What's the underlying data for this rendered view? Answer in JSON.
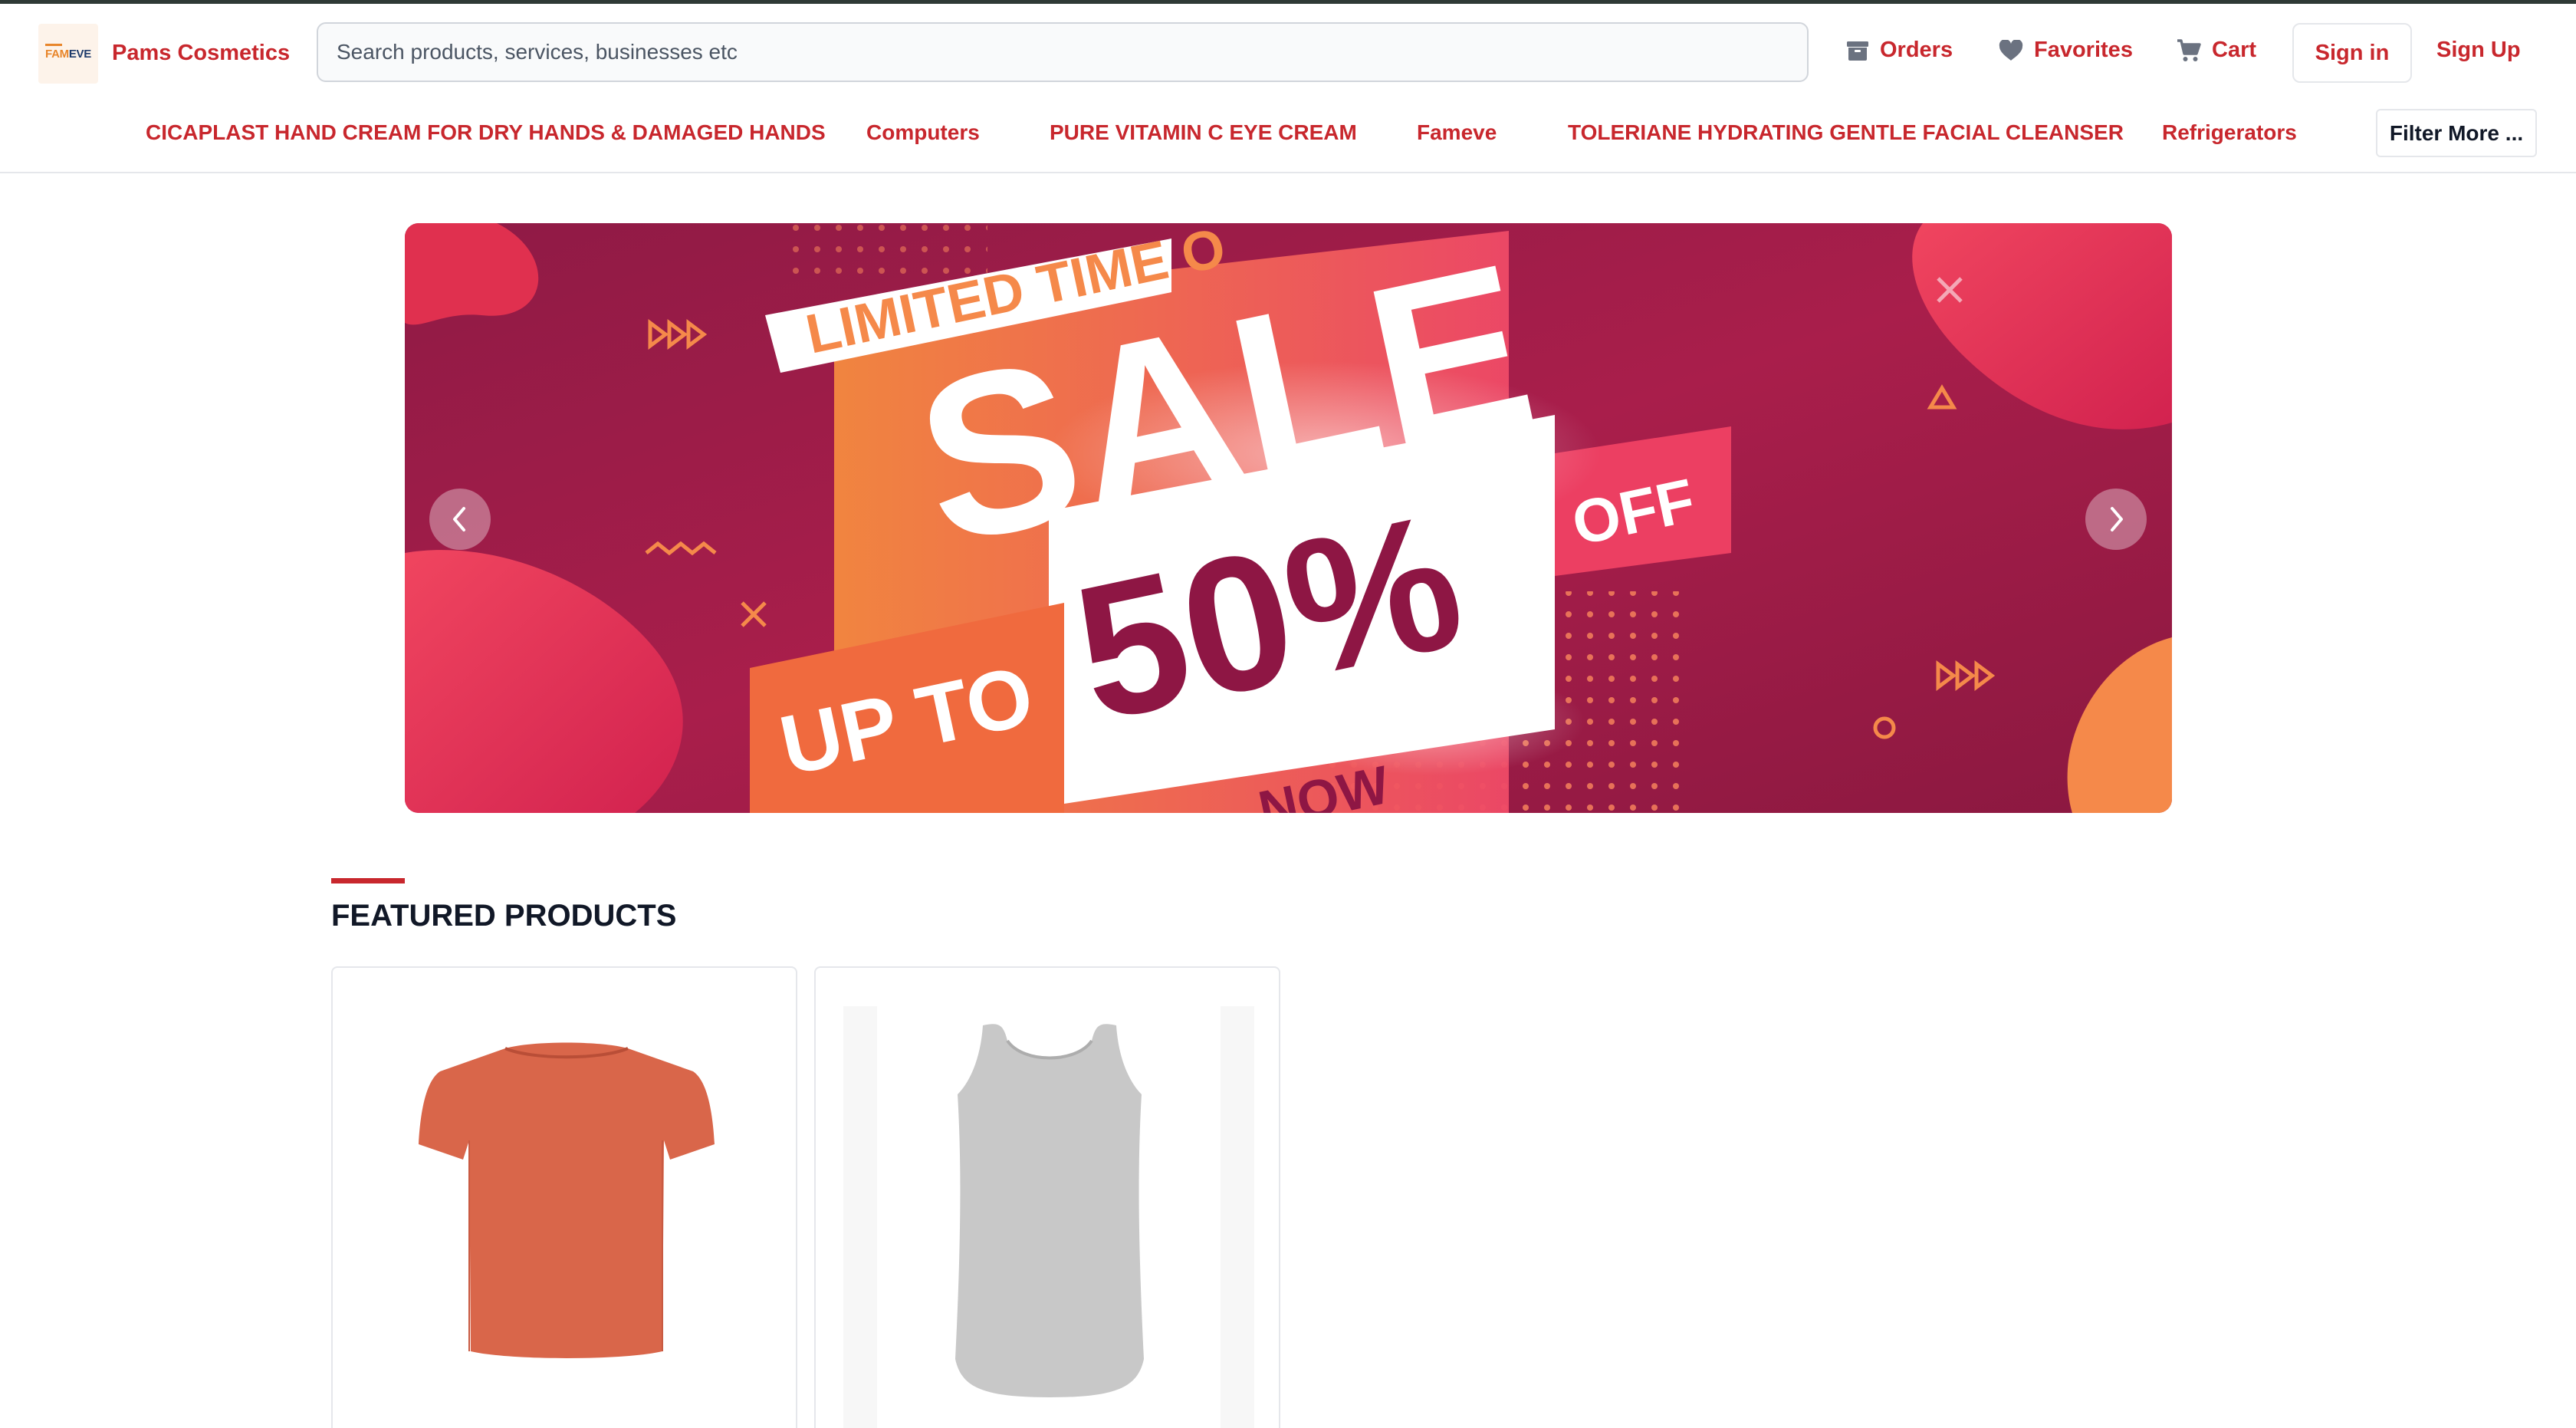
{
  "brand": {
    "logo_text_a": "FAM",
    "logo_text_b": "EVE",
    "name": "Pams Cosmetics"
  },
  "search": {
    "placeholder": "Search products, services, businesses etc"
  },
  "header_links": {
    "orders": "Orders",
    "favorites": "Favorites",
    "cart": "Cart",
    "sign_in": "Sign in",
    "sign_up": "Sign Up"
  },
  "categories": [
    "CICAPLAST HAND CREAM FOR DRY HANDS & DAMAGED HANDS",
    "Computers",
    "PURE VITAMIN C EYE CREAM",
    "Fameve",
    "TOLERIANE HYDRATING GENTLE FACIAL CLEANSER",
    "Refrigerators"
  ],
  "filter_more": "Filter More ...",
  "banner": {
    "ribbon": "LIMITED TIME O",
    "headline": "SALE",
    "up_to": "UP TO",
    "percent": "50%",
    "off": "OFF",
    "bottom": "NOW"
  },
  "featured": {
    "title": "FEATURED PRODUCTS"
  },
  "icons": {
    "orders": "archive-box-icon",
    "favorites": "heart-icon",
    "cart": "shopping-cart-icon",
    "prev": "chevron-left-icon",
    "next": "chevron-right-icon"
  },
  "colors": {
    "accent": "#c8272d",
    "banner_bg": "#a91e4b",
    "banner_orange": "#f5894a",
    "shirt_orange": "#d9664a",
    "tank_gray": "#c8c8c8"
  }
}
